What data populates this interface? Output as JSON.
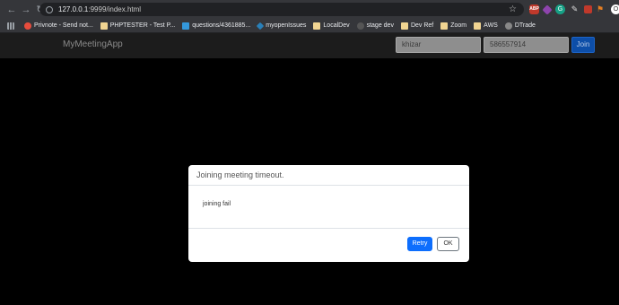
{
  "browser": {
    "url_host": "127.0.0.1",
    "url_rest": ":9999/index.html",
    "bookmarks": [
      {
        "label": "Privnote - Send not...",
        "icon": "privnote-icon"
      },
      {
        "label": "PHPTESTER - Test P...",
        "icon": "phptester-icon"
      },
      {
        "label": "questions/4361885...",
        "icon": "stackoverflow-icon"
      },
      {
        "label": "myopenIssues",
        "icon": "jira-icon"
      },
      {
        "label": "LocalDev",
        "icon": "folder-icon"
      },
      {
        "label": "stage dev",
        "icon": "github-icon"
      },
      {
        "label": "Dev Ref",
        "icon": "folder-icon"
      },
      {
        "label": "Zoom",
        "icon": "folder-icon"
      },
      {
        "label": "AWS",
        "icon": "folder-icon"
      },
      {
        "label": "DTrade",
        "icon": "globe-icon"
      }
    ],
    "extensions": {
      "abp_label": "ABP",
      "grammarly_label": "G",
      "last_label": "O"
    }
  },
  "app": {
    "brand": "MyMeetingApp",
    "name_value": "khizar",
    "meeting_value": "586557914",
    "join_label": "Join"
  },
  "modal": {
    "title": "Joining meeting timeout.",
    "body": "joining fail",
    "retry_label": "Retry",
    "ok_label": "OK"
  }
}
